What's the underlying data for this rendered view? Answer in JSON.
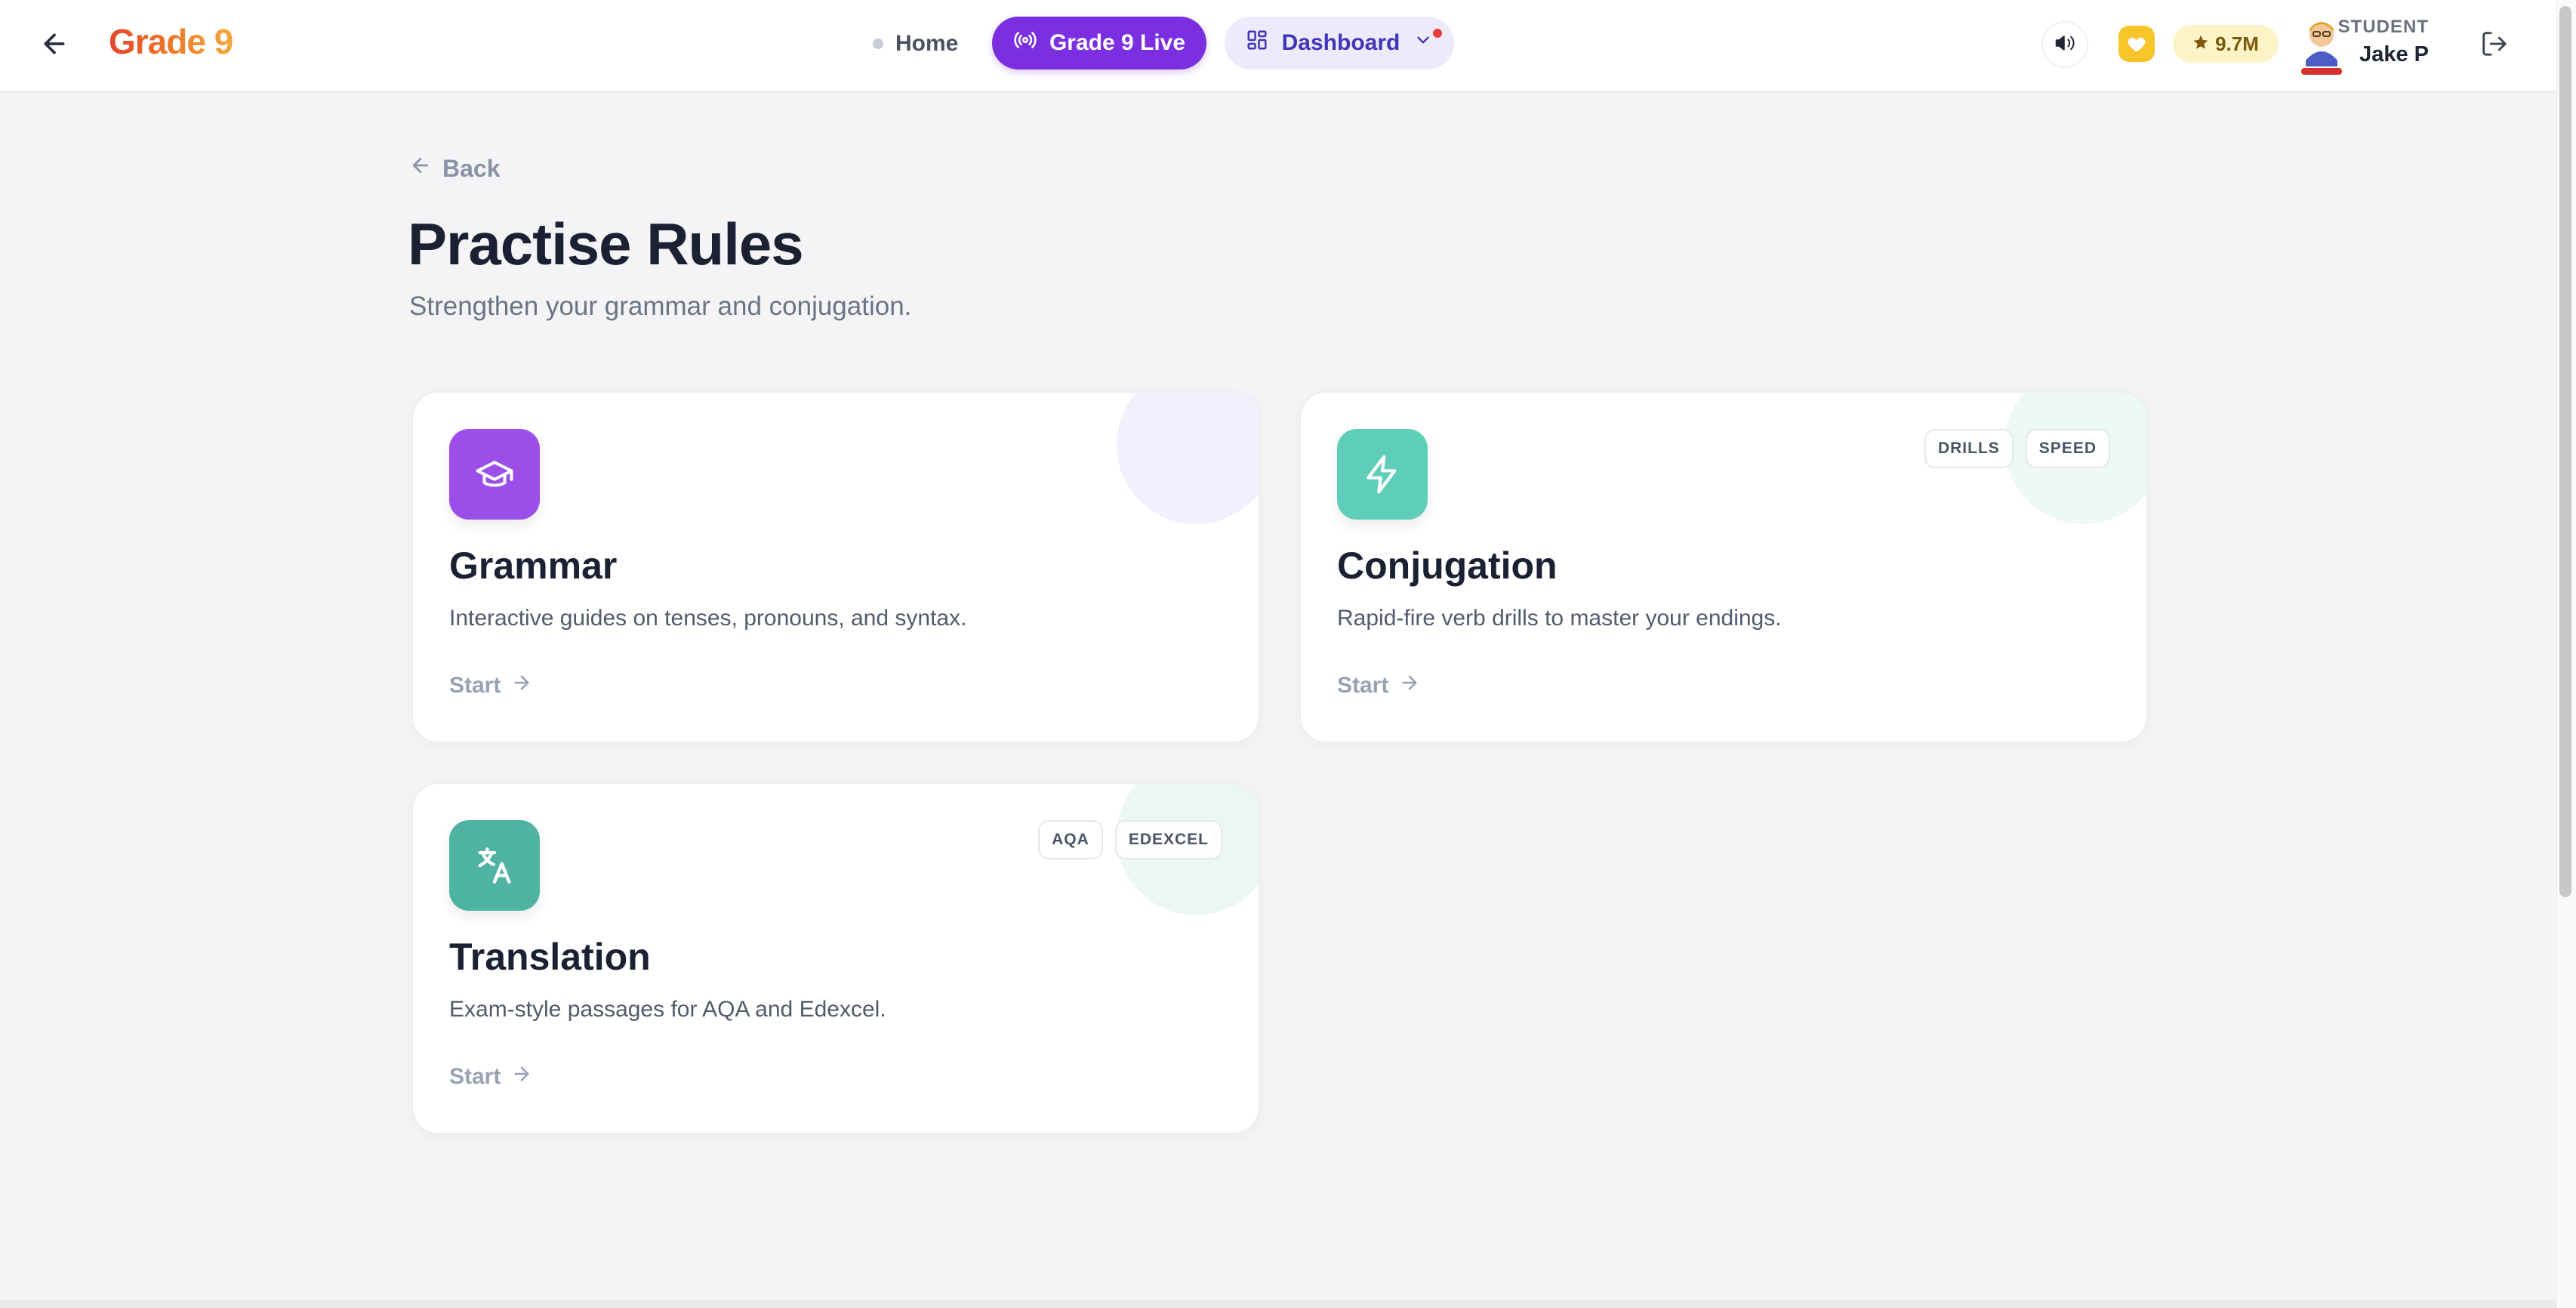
{
  "header": {
    "logo": "Grade 9",
    "nav": {
      "home": "Home",
      "live": "Grade 9 Live",
      "dashboard": "Dashboard"
    },
    "stars": "9.7M",
    "user": {
      "role": "STUDENT",
      "name": "Jake P"
    }
  },
  "page": {
    "back": "Back",
    "title": "Practise Rules",
    "subtitle": "Strengthen your grammar and conjugation."
  },
  "cards": [
    {
      "title": "Grammar",
      "description": "Interactive guides on tenses, pronouns, and syntax.",
      "cta": "Start",
      "icon": "graduation-cap-icon",
      "color": "#9b4ee8",
      "tags": []
    },
    {
      "title": "Conjugation",
      "description": "Rapid-fire verb drills to master your endings.",
      "cta": "Start",
      "icon": "lightning-bolt-icon",
      "color": "#5fceb8",
      "tags": [
        "DRILLS",
        "SPEED"
      ]
    },
    {
      "title": "Translation",
      "description": "Exam-style passages for AQA and Edexcel.",
      "cta": "Start",
      "icon": "translate-icon",
      "color": "#4fb3a1",
      "tags": [
        "AQA",
        "EDEXCEL"
      ]
    }
  ],
  "colors": {
    "primary": "#7b2fe0",
    "dashboard_text": "#4433b8",
    "accent_yellow": "#f7c52a"
  }
}
